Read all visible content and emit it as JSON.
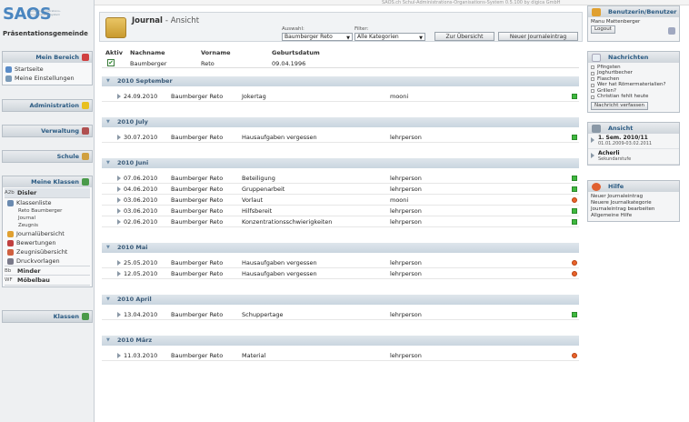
{
  "system_info": "SAOS.ch Schul-Administrations-Organisations-System 0.5.100 by digica GmbH",
  "logo": "SAOS",
  "logo_subtitle": "Schul-Administrations-Organisations-System",
  "school": "Präsentationsgemeinde",
  "left": {
    "mein_bereich": {
      "title": "Mein Bereich",
      "items": [
        "Startseite",
        "Meine Einstellungen"
      ]
    },
    "administration": "Administration",
    "verwaltung": "Verwaltung",
    "schule": "Schule",
    "meine_klassen": {
      "title": "Meine Klassen",
      "class1": {
        "tag": "A2b",
        "name": "Disler"
      },
      "klassenliste": "Klassenliste",
      "sub": [
        "Reto Baumberger",
        "Journal",
        "Zeugnis"
      ],
      "items": [
        "Journalübersicht",
        "Bewertungen",
        "Zeugnisübersicht",
        "Druckvorlagen"
      ],
      "class2": {
        "tag": "Bb",
        "name": "Minder"
      },
      "class3": {
        "tag": "WF",
        "name": "Möbelbau"
      }
    },
    "klassen": "Klassen"
  },
  "header": {
    "title": "Journal",
    "subtitle": "- Ansicht",
    "auswahl_label": "Auswahl:",
    "auswahl_value": "Baumberger Reto",
    "filter_label": "Filter:",
    "filter_value": "Alle Kategorien",
    "btn_overview": "Zur Übersicht",
    "btn_new": "Neuer Journaleintrag"
  },
  "columns": {
    "aktiv": "Aktiv",
    "nachname": "Nachname",
    "vorname": "Vorname",
    "geburtsdatum": "Geburtsdatum"
  },
  "student": {
    "nachname": "Baumberger",
    "vorname": "Reto",
    "geburtsdatum": "09.04.1996"
  },
  "sections": [
    {
      "title": "2010 September",
      "rows": [
        {
          "date": "24.09.2010",
          "name": "Baumberger Reto",
          "topic": "Jokertag",
          "user": "mooni",
          "status": "green"
        }
      ]
    },
    {
      "title": "2010 July",
      "rows": [
        {
          "date": "30.07.2010",
          "name": "Baumberger Reto",
          "topic": "Hausaufgaben vergessen",
          "user": "lehrperson",
          "status": "green"
        }
      ]
    },
    {
      "title": "2010 Juni",
      "rows": [
        {
          "date": "07.06.2010",
          "name": "Baumberger Reto",
          "topic": "Beteiligung",
          "user": "lehrperson",
          "status": "green"
        },
        {
          "date": "04.06.2010",
          "name": "Baumberger Reto",
          "topic": "Gruppenarbeit",
          "user": "lehrperson",
          "status": "green"
        },
        {
          "date": "03.06.2010",
          "name": "Baumberger Reto",
          "topic": "Vorlaut",
          "user": "mooni",
          "status": "red"
        },
        {
          "date": "03.06.2010",
          "name": "Baumberger Reto",
          "topic": "Hilfsbereit",
          "user": "lehrperson",
          "status": "green"
        },
        {
          "date": "02.06.2010",
          "name": "Baumberger Reto",
          "topic": "Konzentrationsschwierigkeiten",
          "user": "lehrperson",
          "status": "green"
        }
      ]
    },
    {
      "title": "2010 Mai",
      "rows": [
        {
          "date": "25.05.2010",
          "name": "Baumberger Reto",
          "topic": "Hausaufgaben vergessen",
          "user": "lehrperson",
          "status": "red"
        },
        {
          "date": "12.05.2010",
          "name": "Baumberger Reto",
          "topic": "Hausaufgaben vergessen",
          "user": "lehrperson",
          "status": "red"
        }
      ]
    },
    {
      "title": "2010 April",
      "rows": [
        {
          "date": "13.04.2010",
          "name": "Baumberger Reto",
          "topic": "Schuppertage",
          "user": "lehrperson",
          "status": "green"
        }
      ]
    },
    {
      "title": "2010 März",
      "rows": [
        {
          "date": "11.03.2010",
          "name": "Baumberger Reto",
          "topic": "Material",
          "user": "lehrperson",
          "status": "red"
        }
      ]
    }
  ],
  "right": {
    "benutzer": {
      "title": "Benutzerin/Benutzer",
      "name": "Manu Mattenberger",
      "logout": "Logout"
    },
    "nachrichten": {
      "title": "Nachrichten",
      "items": [
        "Pfingsten",
        "Joghurtbecher",
        "Flaschen",
        "Wer hat Römermaterialien?",
        "Grillen?",
        "Christian fehlt heute"
      ],
      "btn": "Nachricht verfassen"
    },
    "ansicht": {
      "title": "Ansicht",
      "sem": "1. Sem. 2010/11",
      "sem_dates": "01.01.2009-03.02.2011",
      "place": "Acherli",
      "place_sub": "Sekundarstufe"
    },
    "hilfe": {
      "title": "Hilfe",
      "links": [
        "Neuer Journaleintrag",
        "Neuere Journalkategorie",
        "Journaleintrag bearbeiten",
        "Allgemeine Hilfe"
      ]
    }
  },
  "colors": {
    "accent": "#4a86c0",
    "section_bg": "#c9d5df",
    "status_green": "#3fb83f",
    "status_red": "#e8632b"
  }
}
